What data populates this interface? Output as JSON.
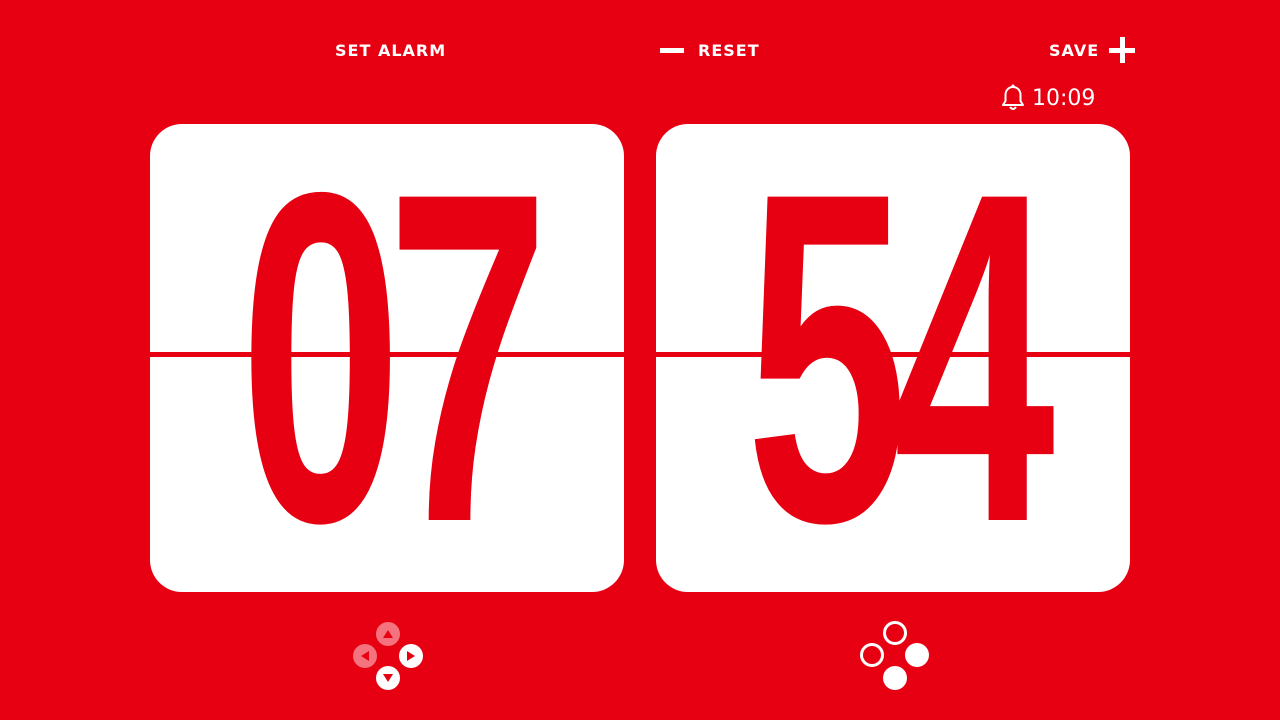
{
  "toolbar": {
    "set_alarm_label": "SET ALARM",
    "reset_label": "RESET",
    "save_label": "SAVE"
  },
  "alarm": {
    "time": "10:09",
    "icon": "bell-icon"
  },
  "clock": {
    "hours": "07",
    "minutes": "54"
  },
  "controls": {
    "left": {
      "type": "dpad",
      "buttons": [
        "up",
        "left",
        "right",
        "down"
      ],
      "active": [
        "right",
        "down"
      ]
    },
    "right": {
      "type": "face-buttons",
      "buttons": [
        "top",
        "left",
        "right",
        "bottom"
      ],
      "filled": [
        "right",
        "bottom"
      ]
    }
  },
  "colors": {
    "background": "#e60012",
    "card": "#ffffff",
    "digit": "#e60012",
    "text": "#ffffff",
    "inactive_button": "#f5737e"
  }
}
